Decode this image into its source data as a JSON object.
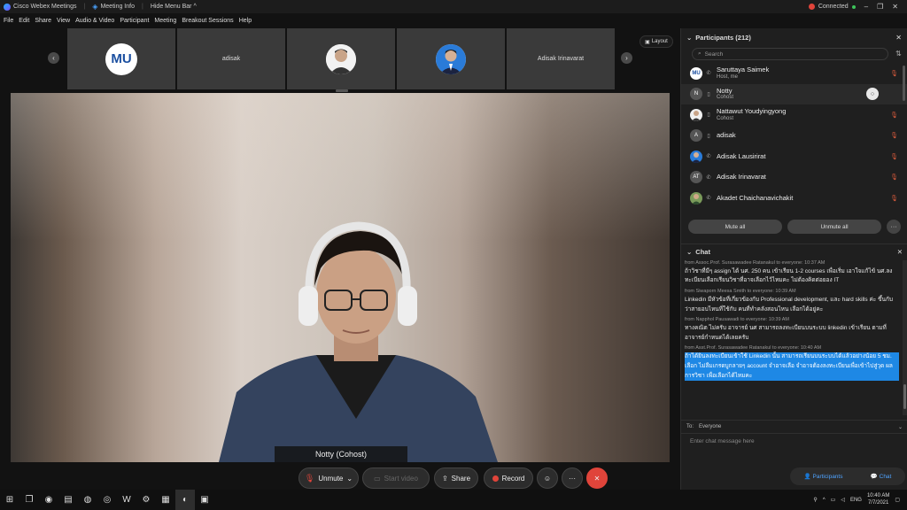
{
  "titlebar": {
    "app_title": "Cisco Webex Meetings",
    "meeting_info": "Meeting Info",
    "hide_menu": "Hide Menu Bar ^",
    "status": "Connected",
    "min": "–",
    "restore": "❐",
    "close": "✕"
  },
  "menu": [
    "File",
    "Edit",
    "Share",
    "View",
    "Audio & Video",
    "Participant",
    "Meeting",
    "Breakout Sessions",
    "Help"
  ],
  "thumbnails": [
    {
      "type": "logo",
      "label": "MU"
    },
    {
      "type": "name",
      "label": "adisak"
    },
    {
      "type": "photo",
      "label": ""
    },
    {
      "type": "photo2",
      "label": ""
    },
    {
      "type": "name",
      "label": "Adisak Irinavarat"
    }
  ],
  "layout_label": "Layout",
  "video": {
    "name_label": "Notty (Cohost)"
  },
  "controls": {
    "unmute": "Unmute",
    "start_video": "Start video",
    "share": "Share",
    "record": "Record",
    "more": "···",
    "end": "✕"
  },
  "participants": {
    "header": "Participants (212)",
    "search_placeholder": "Search",
    "items": [
      {
        "name": "Saruttaya Saimek",
        "role": "Host, me",
        "avatar": "MU"
      },
      {
        "name": "Notty",
        "role": "Cohost",
        "avatar": "N"
      },
      {
        "name": "Nattawut Youdyingyong",
        "role": "Cohost",
        "avatar": ""
      },
      {
        "name": "adisak",
        "role": "",
        "avatar": "A"
      },
      {
        "name": "Adisak Lausirirat",
        "role": "",
        "avatar": ""
      },
      {
        "name": "Adisak Irinavarat",
        "role": "",
        "avatar": "AT"
      },
      {
        "name": "Akadet Chaichanavichakit",
        "role": "",
        "avatar": ""
      }
    ],
    "mute_all": "Mute all",
    "unmute_all": "Unmute all"
  },
  "chat": {
    "header": "Chat",
    "messages": [
      {
        "from": "from Assoc.Prof. Surasawadee Ratanakul to everyone:   10:37 AM",
        "text": "ถ้าวิชาที่มีๆ assign ได้ นศ. 250 คน เข้าเรียน 1-2 courses เพื่อเริ่ม เอาใจแก้ไข้ นศ.ลงทะเบียนเลือกเรียนวิชาที่อาจเลือกไว้ไหมคะ ไม่ต้องคิดต่อยอง IT",
        "hl": false
      },
      {
        "from": "from Siwaporn Meesa Smith to everyone:   10:39 AM",
        "text": "Linkedin มีหัวข้อที่เกี่ยวข้องกับ Professional development, และ hard skills ค่ะ ขึ้นกับว่าสายอบไหนที่ใช้กับ คนที่ทำคลังสอนไหน เลือกได้อยู่คะ",
        "hl": false
      },
      {
        "from": "from Napphol Pausawadi to everyone:   10:39 AM",
        "text": "ทางคณิต ไม่ครับ อาจารย์ นศ สามารถลงทะเบียนบนระบบ linkedin เข้าเรียน ตามที่ อาจารย์กำหนดได้เลยครับ",
        "hl": false
      },
      {
        "from": "from Asst.Prof. Surasawadee Ratanakul to everyone:   10:40 AM",
        "text": "ถ้าได้ยินลงทะเบียนเข้าใช้ Linkedin นั้น สามารถเรียนบนระบบได้แล้วอย่างน้อย 5 ชม. เลือก ไม่ลืมเกรดบูกลายๆ account จำอาจเลือ จำอาจต้องลงทะเบียนเพื่อเข้าไปสู่วุด ผลการวิชา เพื่อเลือกได้ไหมคะ",
        "hl": true
      }
    ],
    "to_label": "To:",
    "to_value": "Everyone",
    "input_placeholder": "Enter chat message here"
  },
  "panel_tabs": {
    "participants": "Participants",
    "chat": "Chat"
  },
  "taskbar": {
    "time": "10:40 AM",
    "date": "7/7/2021",
    "lang": "ENG"
  },
  "colors": {
    "accent": "#1e88e5",
    "end": "#e0443a",
    "bg": "#121212"
  }
}
